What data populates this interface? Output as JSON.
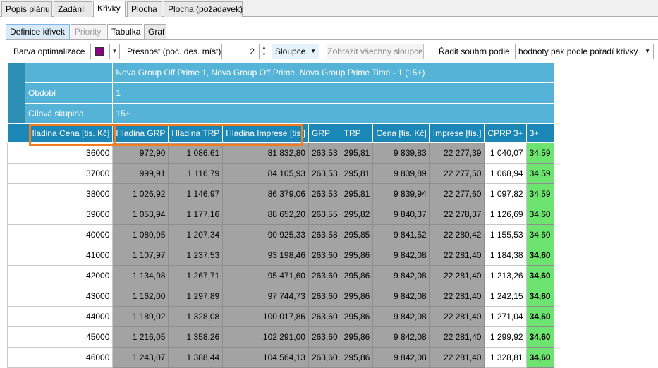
{
  "top_tabs": [
    "Popis plánu",
    "Zadání",
    "Křivky",
    "Plocha",
    "Plocha (požadavek)"
  ],
  "sub_tabs": [
    "Definice křivek",
    "Priority",
    "Tabulka",
    "Graf"
  ],
  "toolbar": {
    "color_label": "Barva optimalizace",
    "color_value": "#8b008b",
    "precision_label": "Přesnost (poč. des. míst):",
    "precision_value": "2",
    "columns_select": "Sloupce",
    "show_all_button": "Zobrazit všechny sloupce",
    "sort_label": "Řadit souhrn podle",
    "sort_select": "hodnoty pak podle pořadí křivky"
  },
  "grid": {
    "title": "Nova Group Off Prime 1, Nova Group Off Prime, Nova Group Prime Time - 1 (15+)",
    "period_label": "Období",
    "period_value": "1",
    "target_label": "Cílová skupina",
    "target_value": "15+",
    "columns": [
      "Hladina Cena [tis. Kč]",
      "Hladina GRP",
      "Hladina TRP",
      "Hladina Imprese [tis.]",
      "GRP",
      "TRP",
      "Cena [tis. Kč]",
      "Imprese [tis.]",
      "CPRP 3+",
      "3+"
    ],
    "rows": [
      [
        "36000",
        "972,90",
        "1 086,61",
        "81 832,80",
        "263,53",
        "295,81",
        "9 839,83",
        "22 277,39",
        "1 040,07",
        "34,59"
      ],
      [
        "37000",
        "999,91",
        "1 116,79",
        "84 105,93",
        "263,53",
        "295,81",
        "9 839,89",
        "22 277,50",
        "1 068,94",
        "34,59"
      ],
      [
        "38000",
        "1 026,92",
        "1 146,97",
        "86 379,06",
        "263,53",
        "295,81",
        "9 839,94",
        "22 277,60",
        "1 097,82",
        "34,59"
      ],
      [
        "39000",
        "1 053,94",
        "1 177,16",
        "88 652,20",
        "263,55",
        "295,82",
        "9 840,37",
        "22 278,37",
        "1 126,69",
        "34,60"
      ],
      [
        "40000",
        "1 080,95",
        "1 207,34",
        "90 925,33",
        "263,58",
        "295,85",
        "9 841,52",
        "22 280,42",
        "1 155,53",
        "34,60"
      ],
      [
        "41000",
        "1 107,97",
        "1 237,53",
        "93 198,46",
        "263,60",
        "295,86",
        "9 842,08",
        "22 281,40",
        "1 184,38",
        "34,60"
      ],
      [
        "42000",
        "1 134,98",
        "1 267,71",
        "95 471,60",
        "263,60",
        "295,86",
        "9 842,08",
        "22 281,40",
        "1 213,26",
        "34,60"
      ],
      [
        "43000",
        "1 162,00",
        "1 297,89",
        "97 744,73",
        "263,60",
        "295,86",
        "9 842,08",
        "22 281,40",
        "1 242,15",
        "34,60"
      ],
      [
        "44000",
        "1 189,02",
        "1 328,08",
        "100 017,86",
        "263,60",
        "295,86",
        "9 842,08",
        "22 281,40",
        "1 271,04",
        "34,60"
      ],
      [
        "45000",
        "1 216,05",
        "1 358,26",
        "102 291,00",
        "263,60",
        "295,86",
        "9 842,08",
        "22 281,40",
        "1 299,92",
        "34,60"
      ],
      [
        "46000",
        "1 243,07",
        "1 388,44",
        "104 564,13",
        "263,60",
        "295,86",
        "9 842,08",
        "22 281,40",
        "1 328,81",
        "34,60"
      ]
    ],
    "bold_last_col_from_row": 5
  },
  "colors": {
    "meta_blue": "#54b3d6",
    "header_blue": "#1b87b6",
    "cell_gray": "#a3a3a3",
    "cell_green": "#6ee470",
    "highlight": "#f47c20"
  }
}
